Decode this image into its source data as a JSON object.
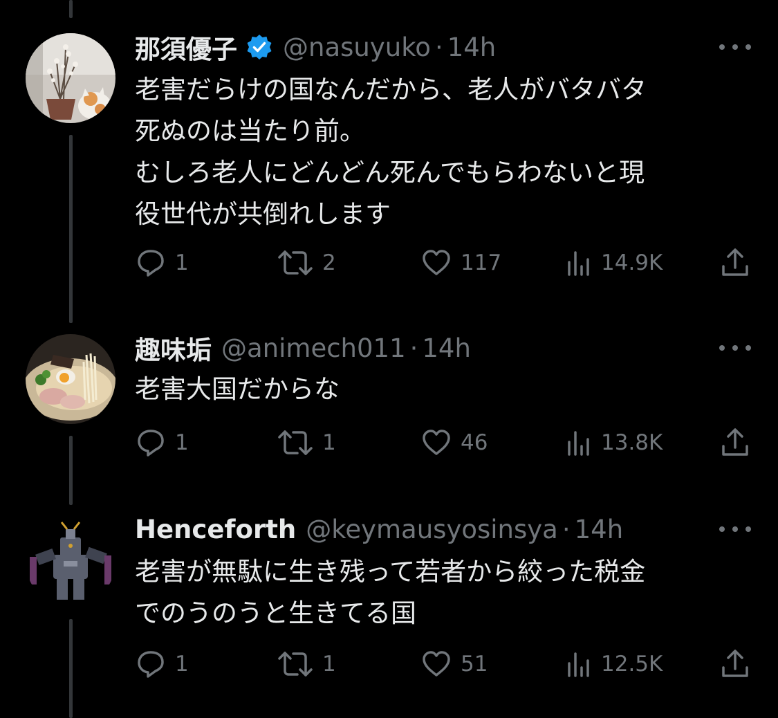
{
  "colors": {
    "background": "#000000",
    "primary_text": "#e7e9ea",
    "secondary_text": "#71767b",
    "verified_badge": "#1d9bf0",
    "thread_line": "#333639"
  },
  "tweets": [
    {
      "name": "那須優子",
      "verified": true,
      "handle": "@nasuyuko",
      "separator": "·",
      "time": "14h",
      "avatar_icon": "avatar-plant-and-cat",
      "lines": [
        "老害だらけの国なんだから、老人がバタバタ",
        "死ぬのは当たり前。",
        "むしろ老人にどんどん死んでもらわないと現",
        "役世代が共倒れします"
      ],
      "replies": "1",
      "reposts": "2",
      "likes": "117",
      "views": "14.9K"
    },
    {
      "name": "趣味垢",
      "verified": false,
      "handle": "@animech011",
      "separator": "·",
      "time": "14h",
      "avatar_icon": "avatar-ramen-bowl",
      "lines": [
        "老害大国だからな"
      ],
      "replies": "1",
      "reposts": "1",
      "likes": "46",
      "views": "13.8K"
    },
    {
      "name": "Henceforth",
      "verified": false,
      "handle": "@keymausyosinsya",
      "separator": "·",
      "time": "14h",
      "avatar_icon": "avatar-robot-figure",
      "lines": [
        "老害が無駄に生き残って若者から絞った税金",
        "でのうのうと生きてる国"
      ],
      "replies": "1",
      "reposts": "1",
      "likes": "51",
      "views": "12.5K"
    }
  ]
}
